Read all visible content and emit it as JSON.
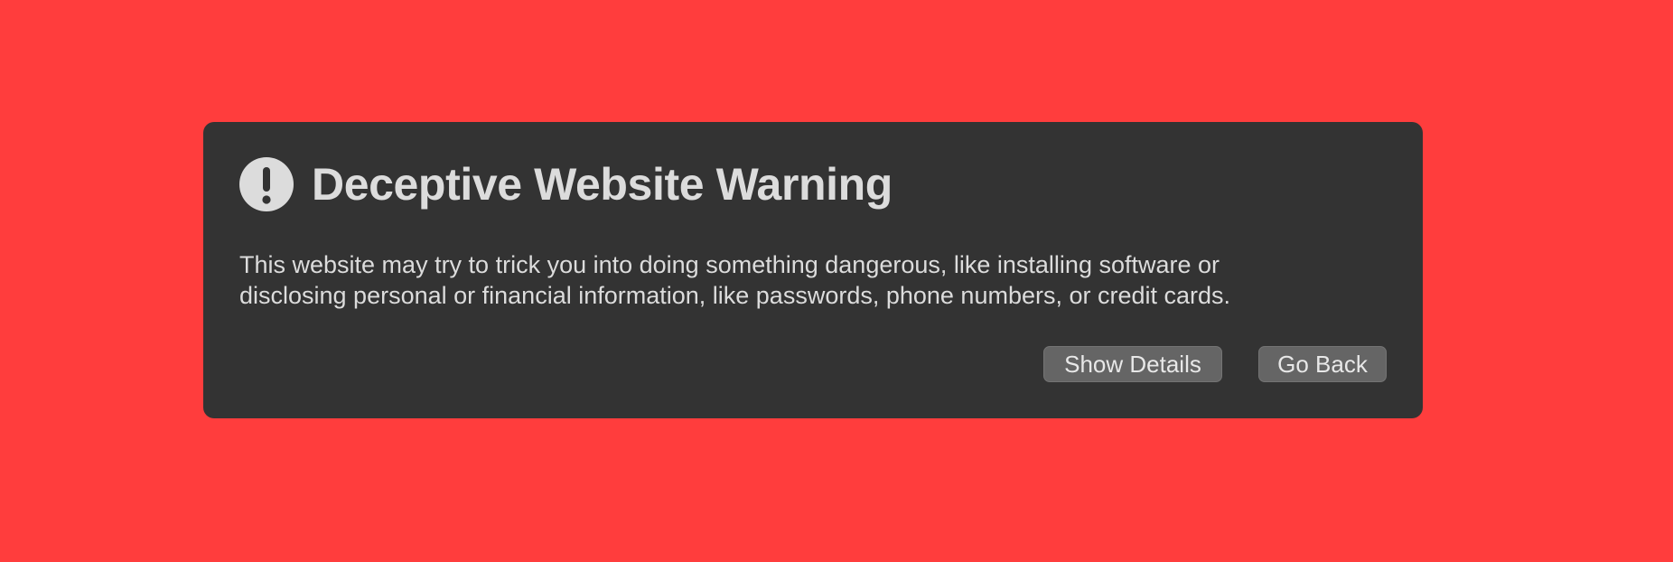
{
  "background_color": "#ff3d3d",
  "panel_color": "#333333",
  "warning": {
    "icon": "exclamation-circle-icon",
    "title": "Deceptive Website Warning",
    "message_lines": [
      "This website may try to trick you into doing something dangerous, like installing software or",
      "disclosing personal or financial information, like passwords, phone numbers, or credit cards."
    ]
  },
  "buttons": {
    "show_details": "Show Details",
    "go_back": "Go Back"
  }
}
